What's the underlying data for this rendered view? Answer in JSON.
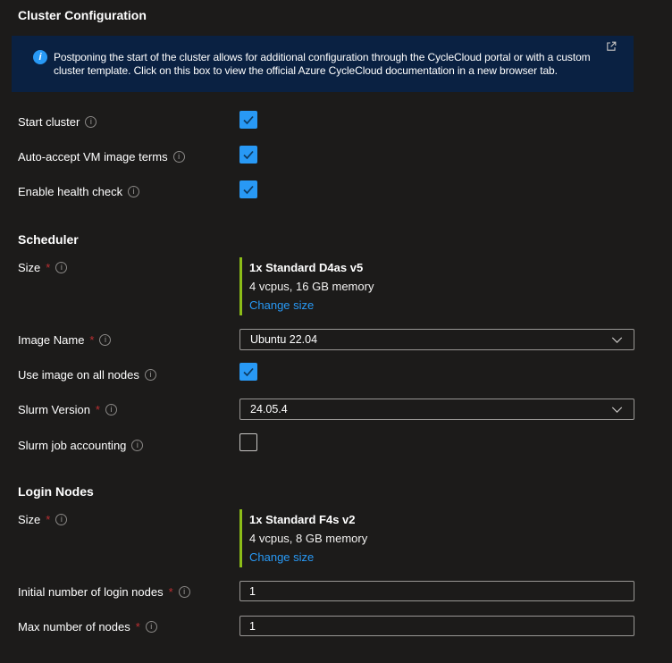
{
  "page_title": "Cluster Configuration",
  "required_marker": "*",
  "icons": {
    "info": "i"
  },
  "colors": {
    "page_background": "#1c1b1a",
    "banner_background": "#0a2142",
    "accent_blue": "#2899f5",
    "accent_green": "#8cbd18",
    "required_red": "#bc2f32",
    "control_border": "#999795"
  },
  "banner": {
    "lines": [
      "Postponing the start of the cluster allows for additional configuration through the CycleCloud portal or with a custom",
      "cluster template. Click on this box to view the official Azure CycleCloud documentation in a new browser tab."
    ]
  },
  "general": {
    "start_cluster": {
      "label": "Start cluster",
      "checked": true
    },
    "auto_accept_vm_image_terms": {
      "label": "Auto-accept VM image terms",
      "checked": true
    },
    "enable_health_check": {
      "label": "Enable health check",
      "checked": true
    }
  },
  "scheduler": {
    "heading": "Scheduler",
    "size": {
      "label": "Size",
      "required": true,
      "selection": "1x Standard D4as v5",
      "specs": "4 vcpus, 16 GB memory",
      "change_link": "Change size"
    },
    "image_name": {
      "label": "Image Name",
      "required": true,
      "value": "Ubuntu 22.04"
    },
    "use_image_on_all_nodes": {
      "label": "Use image on all nodes",
      "checked": true
    },
    "slurm_version": {
      "label": "Slurm Version",
      "required": true,
      "value": "24.05.4"
    },
    "slurm_job_accounting": {
      "label": "Slurm job accounting",
      "checked": false
    }
  },
  "login_nodes": {
    "heading": "Login Nodes",
    "size": {
      "label": "Size",
      "required": true,
      "selection": "1x Standard F4s v2",
      "specs": "4 vcpus, 8 GB memory",
      "change_link": "Change size"
    },
    "initial_number_of_login_nodes": {
      "label": "Initial number of login nodes",
      "required": true,
      "value": "1"
    },
    "max_number_of_nodes": {
      "label": "Max number of nodes",
      "required": true,
      "value": "1"
    }
  }
}
